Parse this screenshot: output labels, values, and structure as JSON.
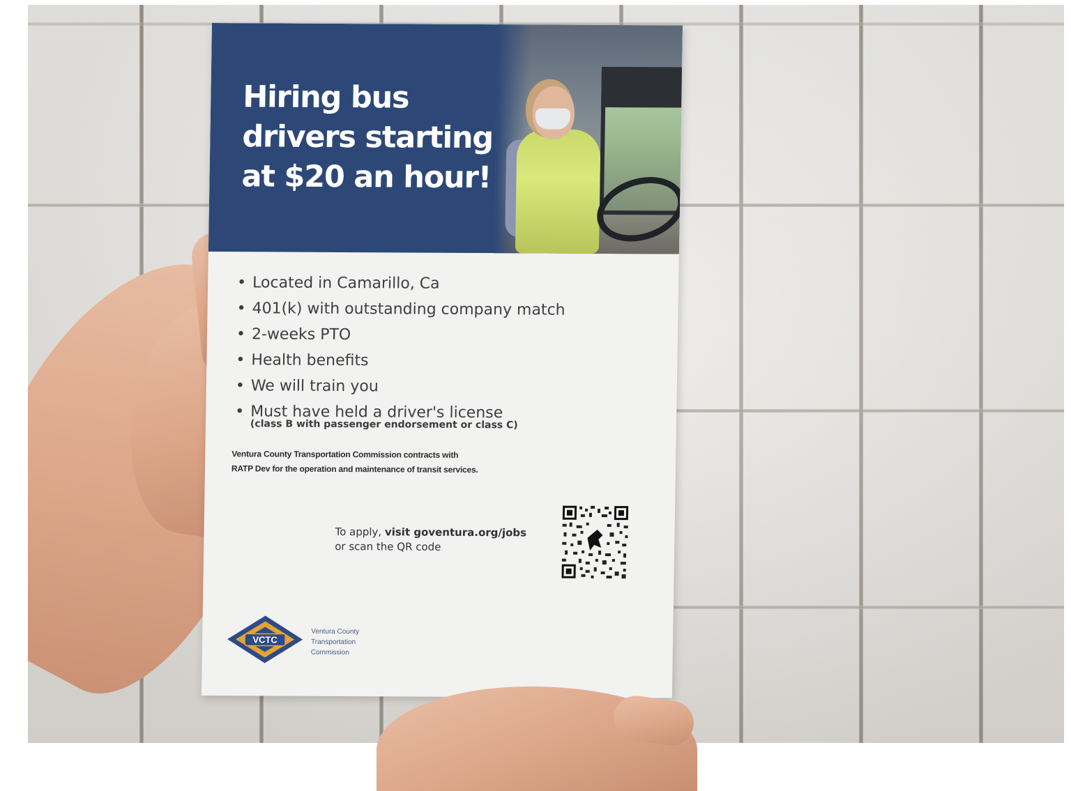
{
  "flyer": {
    "headline": {
      "line1": "Hiring bus",
      "line2": "drivers starting",
      "line3": "at $20 an hour!"
    },
    "bullets": [
      "Located in Camarillo, Ca",
      "401(k) with outstanding company match",
      "2-weeks PTO",
      "Health benefits",
      "We will train you",
      "Must have held a driver's license"
    ],
    "license_note": "(class B with passenger endorsement or class C)",
    "fine_print": {
      "line1": "Ventura County Transportation Commission contracts with",
      "line2": "RATP Dev for the operation and maintenance of transit services."
    },
    "apply": {
      "prefix": "To apply, ",
      "link": "visit goventura.org/jobs",
      "line2": "or scan the QR code"
    },
    "logo": {
      "mark": "VCTC",
      "name_line1": "Ventura County",
      "name_line2": "Transportation",
      "name_line3": "Commission"
    }
  },
  "colors": {
    "banner": "#2d4877",
    "paper": "#f2f2f1",
    "logo_gold": "#e3a436",
    "logo_navy": "#2f4b86"
  },
  "icons": [
    "qr-code-icon",
    "vctc-logo"
  ]
}
